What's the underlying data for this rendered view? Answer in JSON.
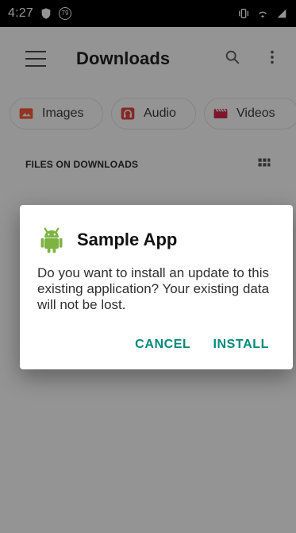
{
  "status_bar": {
    "time": "4:27",
    "badge_number": "79",
    "icons": {
      "left_shield": "shield-icon",
      "right_icons": [
        "vibrate-icon",
        "wifi-icon",
        "signal-icon"
      ]
    }
  },
  "app_bar": {
    "title": "Downloads",
    "icons": {
      "menu": "menu-icon",
      "search": "search-icon",
      "overflow": "more-vert-icon"
    }
  },
  "chips": [
    {
      "label": "Images",
      "icon": "image-icon",
      "color": "#ff5a3c"
    },
    {
      "label": "Audio",
      "icon": "headphones-icon",
      "color": "#e54646"
    },
    {
      "label": "Videos",
      "icon": "video-icon",
      "color": "#d8264d"
    }
  ],
  "section": {
    "title": "FILES ON DOWNLOADS",
    "grid_icon": "grid-icon"
  },
  "dialog": {
    "title": "Sample App",
    "icon": "android-icon",
    "message": "Do you want to install an update to this existing application? Your existing data will not be lost.",
    "actions": {
      "cancel": "CANCEL",
      "install": "INSTALL"
    },
    "accent_color": "#00897b"
  }
}
